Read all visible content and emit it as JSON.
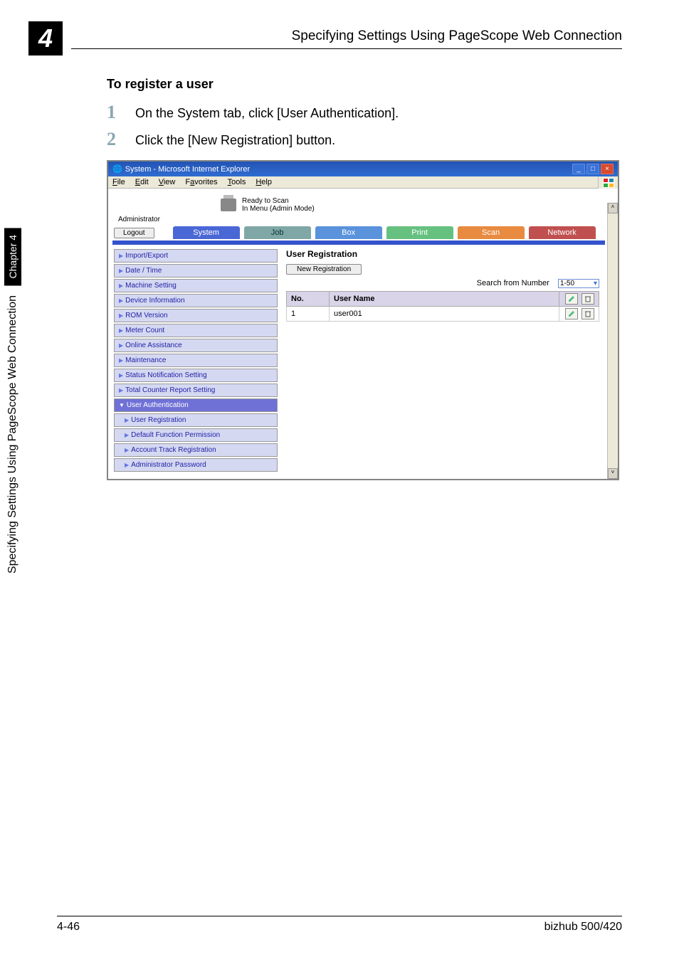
{
  "header": {
    "running_head": "Specifying Settings Using PageScope Web Connection",
    "chapter_num": "4"
  },
  "sidebar_tab": {
    "chapter": "Chapter 4",
    "title": "Specifying Settings Using PageScope Web Connection"
  },
  "section_heading": "To register a user",
  "steps": [
    {
      "num": "1",
      "text": "On the System tab, click [User Authentication]."
    },
    {
      "num": "2",
      "text": "Click the [New Registration] button."
    }
  ],
  "browser": {
    "title": "System - Microsoft Internet Explorer",
    "menus": [
      "File",
      "Edit",
      "View",
      "Favorites",
      "Tools",
      "Help"
    ],
    "status1": "Ready to Scan",
    "status2": "In Menu (Admin Mode)",
    "role": "Administrator",
    "logout": "Logout",
    "tabs": {
      "system": "System",
      "job": "Job",
      "box": "Box",
      "print": "Print",
      "scan": "Scan",
      "network": "Network"
    },
    "side_items": [
      "Import/Export",
      "Date / Time",
      "Machine Setting",
      "Device Information",
      "ROM Version",
      "Meter Count",
      "Online Assistance",
      "Maintenance",
      "Status Notification Setting",
      "Total Counter Report Setting"
    ],
    "side_selected": "User Authentication",
    "side_sub": [
      "User Registration",
      "Default Function Permission",
      "Account Track Registration",
      "Administrator Password"
    ],
    "main": {
      "title": "User Registration",
      "newreg": "New Registration",
      "search_label": "Search from Number",
      "range": "1-50",
      "col_no": "No.",
      "col_name": "User Name",
      "row_no": "1",
      "row_name": "user001"
    }
  },
  "footer": {
    "left": "4-46",
    "right": "bizhub 500/420"
  }
}
